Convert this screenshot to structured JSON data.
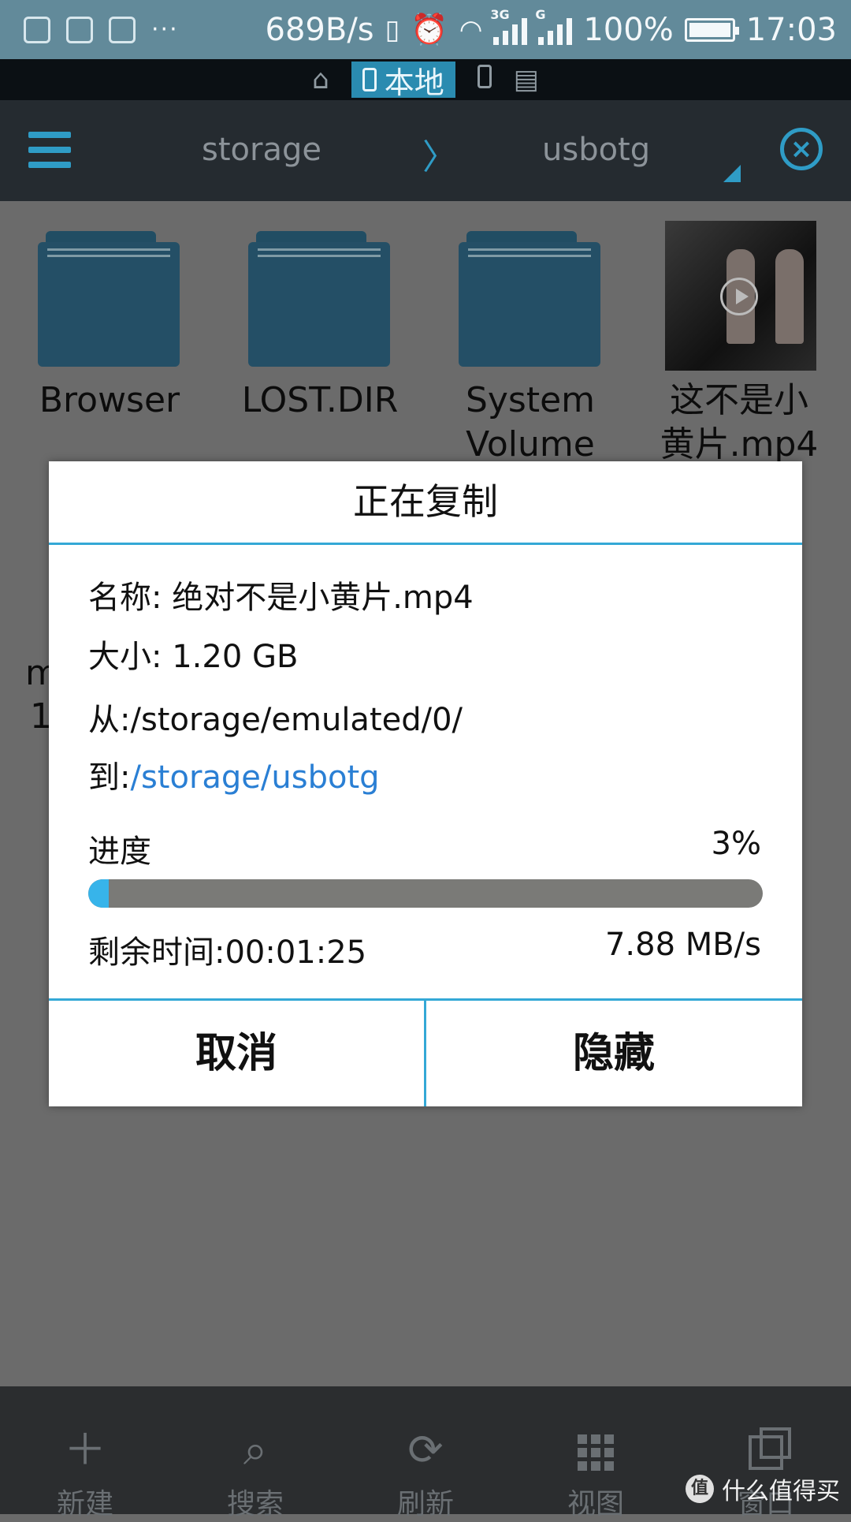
{
  "status_bar": {
    "net_speed": "689B/s",
    "network_3g": "3G",
    "network_g": "G",
    "battery": "100%",
    "time": "17:03",
    "overflow": "···"
  },
  "location_tabs": {
    "local_label": "本地"
  },
  "path": {
    "segments": [
      "storage",
      "usbotg"
    ],
    "separator": "〉"
  },
  "files": [
    {
      "name": "Browser"
    },
    {
      "name": "LOST.DIR"
    },
    {
      "name_line1": "System",
      "name_line2": "Volume"
    },
    {
      "name_line1": "这不是小",
      "name_line2": "黄片.mp4"
    }
  ],
  "partial_file": {
    "line1": "m",
    "line2": "1"
  },
  "dialog": {
    "title": "正在复制",
    "name_label": "名称: ",
    "name_value": "绝对不是小黄片.mp4",
    "size_label": "大小: ",
    "size_value": "1.20 GB",
    "from_label": "从:",
    "from_value": "/storage/emulated/0/",
    "to_label": "到:",
    "to_value": "/storage/usbotg",
    "progress_label": "进度",
    "progress_percent": "3%",
    "progress_value": 3,
    "remaining_label": "剩余时间:",
    "remaining_value": "00:01:25",
    "speed": "7.88 MB/s",
    "cancel_label": "取消",
    "hide_label": "隐藏",
    "accent_color": "#34a8d6",
    "progress_color": "#37b4ea"
  },
  "toolbar": {
    "new_label": "新建",
    "search_label": "搜索",
    "refresh_label": "刷新",
    "view_label": "视图",
    "window_label": "窗口"
  },
  "watermark": {
    "logo": "值",
    "text": "什么值得买"
  }
}
